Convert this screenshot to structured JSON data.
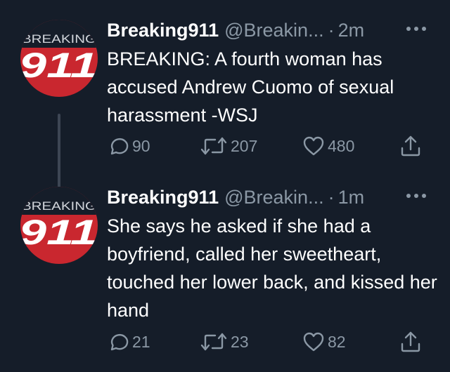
{
  "colors": {
    "background": "#151d29",
    "text": "#ffffff",
    "secondary": "#8b98a5",
    "avatar_red": "#c9272f",
    "thread_line": "#3d4654"
  },
  "icons": {
    "reply": "reply-icon",
    "retweet": "retweet-icon",
    "like": "heart-icon",
    "share": "share-icon",
    "more": "more-icon"
  },
  "tweets": [
    {
      "display_name": "Breaking911",
      "handle": "@Breakin...",
      "separator": "·",
      "time": "2m",
      "text": "BREAKING: A fourth woman has accused Andrew Cuomo of sexual harassment -WSJ",
      "avatar": {
        "banner": "BREAKING",
        "number": "911"
      },
      "replies": "90",
      "retweets": "207",
      "likes": "480"
    },
    {
      "display_name": "Breaking911",
      "handle": "@Breakin...",
      "separator": "·",
      "time": "1m",
      "text": "She says he asked if she had a boyfriend, called her sweetheart, touched her lower back, and kissed her hand",
      "avatar": {
        "banner": "BREAKING",
        "number": "911"
      },
      "replies": "21",
      "retweets": "23",
      "likes": "82"
    }
  ]
}
